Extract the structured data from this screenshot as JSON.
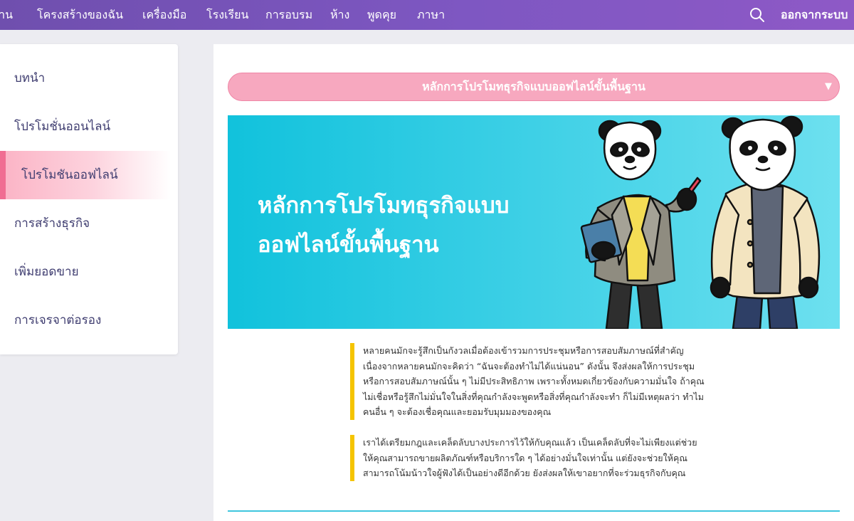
{
  "nav": {
    "items": [
      "บ้าน",
      "โครงสร้างของฉัน",
      "เครื่องมือ",
      "โรงเรียน",
      "การอบรม",
      "ห้าง",
      "พูดคุย",
      "ภาษา"
    ],
    "logout": "ออกจากระบบ",
    "search_icon": "search-icon"
  },
  "sidebar": {
    "items": [
      {
        "label": "บทนำ"
      },
      {
        "label": "โปรโมชั่นออนไลน์"
      },
      {
        "label": "โปรโมชันออฟไลน์",
        "active": true
      },
      {
        "label": "การสร้างธุรกิจ"
      },
      {
        "label": "เพิ่มยอดขาย"
      },
      {
        "label": "การเจรจาต่อรอง"
      }
    ]
  },
  "main": {
    "dropdown": {
      "selected": "หลักการโปรโมทธุรกิจแบบออฟไลน์ขั้นพื้นฐาน",
      "caret_icon": "caret-down-icon"
    },
    "hero": {
      "title_line1": "หลักการโปรโมทธุรกิจแบบ",
      "title_line2": "ออฟไลน์ขั้นพื้นฐาน"
    },
    "paragraphs": [
      "หลายคนมักจะรู้สึกเป็นกังวลเมื่อต้องเข้ารวมการประชุมหรือการสอบสัมภาษณ์ที่สำคัญ เนื่องจากหลายคนมักจะคิดว่า “ฉันจะต้องทำไม่ได้แน่นอน” ดังนั้น จึงส่งผลให้การประชุมหรือการสอบสัมภาษณ์นั้น ๆ ไม่มีประสิทธิภาพ เพราะทั้งหมดเกี่ยวข้องกับความมั่นใจ ถ้าคุณไม่เชื่อหรือรู้สึกไม่มั่นใจในสิ่งที่คุณกำลังจะพูดหรือสิ่งที่คุณกำลังจะทำ ก็ไม่มีเหตุผลว่า ทำไมคนอื่น ๆ จะต้องเชื่อคุณและยอมรับมุมมองของคุณ",
      "เราได้เตรียมกฎและเคล็ดลับบางประการไว้ให้กับคุณแล้ว เป็นเคล็ดลับที่จะไม่เพียงแต่ช่วย ให้คุณสามารถขายผลิตภัณฑ์หรือบริการใด ๆ ได้อย่างมั่นใจเท่านั้น แต่ยังจะช่วยให้คุณสามารถโน้มน้าวใจผู้ฟังได้เป็นอย่างดีอีกด้วย ยังส่งผลให้เขาอยากที่จะร่วมธุรกิจกับคุณ"
    ]
  },
  "colors": {
    "nav_gradient_start": "#6f4fae",
    "nav_gradient_end": "#8e59c6",
    "accent_pink": "#f06d92",
    "hero_cyan": "#11c2dc",
    "quote_bar": "#f5c400",
    "text": "#3f3d70"
  }
}
